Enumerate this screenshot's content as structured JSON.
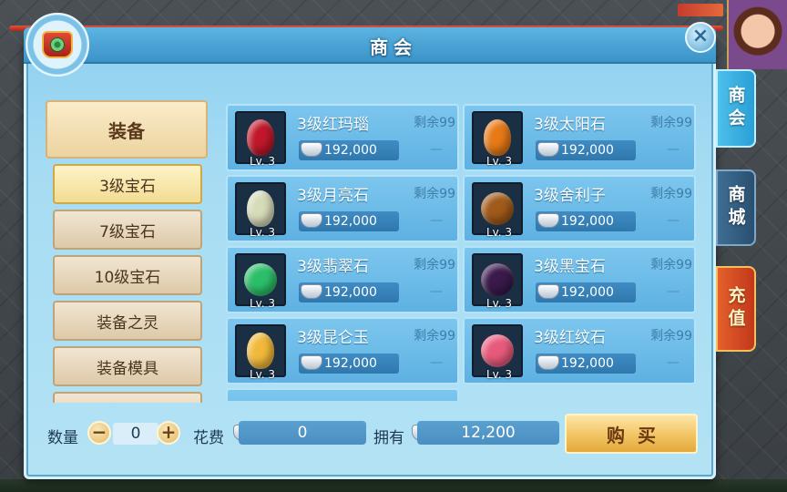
{
  "window": {
    "title": "商会",
    "close_label": "×"
  },
  "side_tabs": [
    {
      "label": "商会"
    },
    {
      "label": "商城"
    },
    {
      "label": "充值"
    }
  ],
  "category": {
    "main": "装备",
    "items": [
      {
        "label": "3级宝石",
        "active": true
      },
      {
        "label": "7级宝石"
      },
      {
        "label": "10级宝石"
      },
      {
        "label": "装备之灵"
      },
      {
        "label": "装备模具"
      },
      {
        "label": ""
      }
    ]
  },
  "items": [
    {
      "name": "3级红玛瑙",
      "remain": "剩余99",
      "price": "192,000",
      "lv": "Lv. 3",
      "dash": "—",
      "color": "#c0182a",
      "shape": "oval"
    },
    {
      "name": "3级太阳石",
      "remain": "剩余99",
      "price": "192,000",
      "lv": "Lv. 3",
      "dash": "—",
      "color": "#e77a16",
      "shape": "oval"
    },
    {
      "name": "3级月亮石",
      "remain": "剩余99",
      "price": "192,000",
      "lv": "Lv. 3",
      "dash": "—",
      "color": "#d6dcb8",
      "shape": "oval"
    },
    {
      "name": "3级舍利子",
      "remain": "剩余99",
      "price": "192,000",
      "lv": "Lv. 3",
      "dash": "—",
      "color": "#a05a1a",
      "shape": "round"
    },
    {
      "name": "3级翡翠石",
      "remain": "剩余99",
      "price": "192,000",
      "lv": "Lv. 3",
      "dash": "—",
      "color": "#2bbf6a",
      "shape": "round"
    },
    {
      "name": "3级黑宝石",
      "remain": "剩余99",
      "price": "192,000",
      "lv": "Lv. 3",
      "dash": "—",
      "color": "#3a1a4c",
      "shape": "round"
    },
    {
      "name": "3级昆仑玉",
      "remain": "剩余99",
      "price": "192,000",
      "lv": "Lv. 3",
      "dash": "—",
      "color": "#f1b83a",
      "shape": "oval"
    },
    {
      "name": "3级红纹石",
      "remain": "剩余99",
      "price": "192,000",
      "lv": "Lv. 3",
      "dash": "—",
      "color": "#e85a7c",
      "shape": "round"
    }
  ],
  "bottom": {
    "qty_label": "数量",
    "minus": "−",
    "qty_value": "0",
    "plus": "+",
    "cost_label": "花费",
    "cost_value": "0",
    "own_label": "拥有",
    "own_value": "12,200",
    "buy_label": "购买"
  }
}
